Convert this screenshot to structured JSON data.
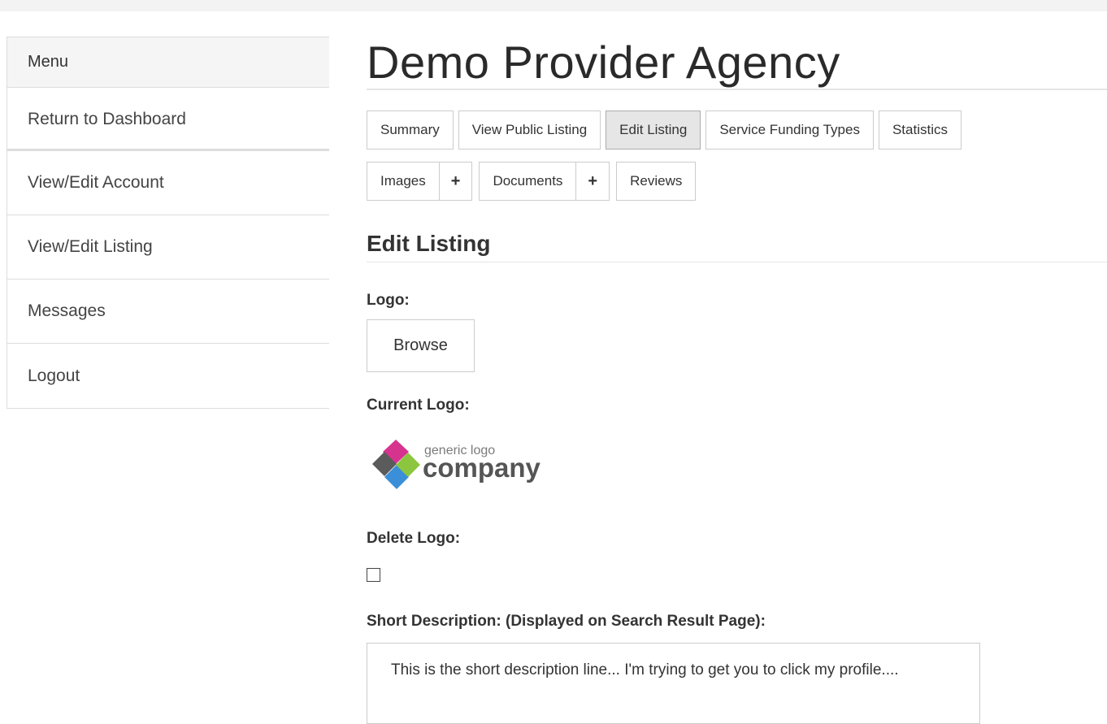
{
  "sidebar": {
    "header": "Menu",
    "items": [
      {
        "label": "Return to Dashboard"
      },
      {
        "label": "View/Edit Account"
      },
      {
        "label": "View/Edit Listing"
      },
      {
        "label": "Messages"
      },
      {
        "label": "Logout"
      }
    ]
  },
  "main": {
    "title": "Demo Provider Agency",
    "tabs_row1": [
      {
        "label": "Summary"
      },
      {
        "label": "View Public Listing"
      },
      {
        "label": "Edit Listing",
        "active": true
      },
      {
        "label": "Service Funding Types"
      },
      {
        "label": "Statistics"
      }
    ],
    "tabs_row2": {
      "images": "Images",
      "images_add": "+",
      "documents": "Documents",
      "documents_add": "+",
      "reviews": "Reviews"
    },
    "section_title": "Edit Listing",
    "form": {
      "logo_label": "Logo:",
      "browse_label": "Browse",
      "current_logo_label": "Current Logo:",
      "logo_image": {
        "small_text": "generic logo",
        "big_text": "company",
        "colors": [
          "#d6338f",
          "#5b5b5b",
          "#3a8fd8",
          "#8cc63f"
        ]
      },
      "delete_logo_label": "Delete Logo:",
      "delete_logo_checked": false,
      "short_description_label": "Short Description: (Displayed on Search Result Page):",
      "short_description_value": "This is the short description line... I'm trying to get you to click my profile...."
    }
  }
}
